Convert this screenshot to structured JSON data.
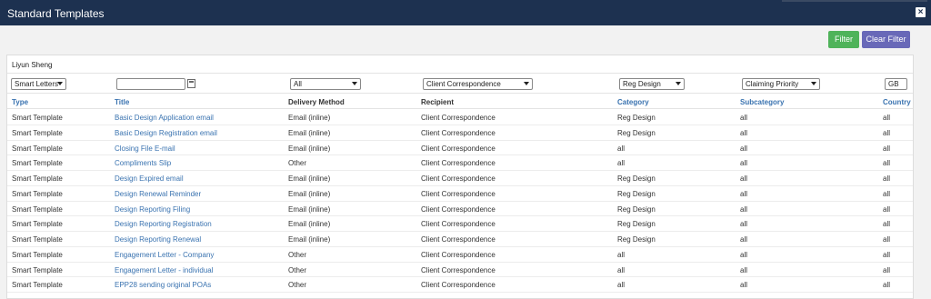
{
  "window": {
    "title": "Standard Templates",
    "close_icon": "×"
  },
  "toolbar": {
    "filter_label": "Filter",
    "clear_filter_label": "Clear Filter"
  },
  "user": "Liyun Sheng",
  "filters": {
    "type": "Smart Letters",
    "title": "",
    "delivery": "All",
    "recipient": "Client Correspondence",
    "category": "Reg Design",
    "subcategory": "Claiming Priority",
    "country": "GB"
  },
  "headers": [
    "Type",
    "Title",
    "Delivery Method",
    "Recipient",
    "Category",
    "Subcategory",
    "Country"
  ],
  "rows": [
    [
      "Smart Template",
      "Basic Design Application email",
      "Email (inline)",
      "Client Correspondence",
      "Reg Design",
      "all",
      "all"
    ],
    [
      "Smart Template",
      "Basic Design Registration email",
      "Email (inline)",
      "Client Correspondence",
      "Reg Design",
      "all",
      "all"
    ],
    [
      "Smart Template",
      "Closing File E-mail",
      "Email (inline)",
      "Client Correspondence",
      "all",
      "all",
      "all"
    ],
    [
      "Smart Template",
      "Compliments Slip",
      "Other",
      "Client Correspondence",
      "all",
      "all",
      "all"
    ],
    [
      "Smart Template",
      "Design Expired email",
      "Email (inline)",
      "Client Correspondence",
      "Reg Design",
      "all",
      "all"
    ],
    [
      "Smart Template",
      "Design Renewal Reminder",
      "Email (inline)",
      "Client Correspondence",
      "Reg Design",
      "all",
      "all"
    ],
    [
      "Smart Template",
      "Design Reporting Filing",
      "Email (inline)",
      "Client Correspondence",
      "Reg Design",
      "all",
      "all"
    ],
    [
      "Smart Template",
      "Design Reporting Registration",
      "Email (inline)",
      "Client Correspondence",
      "Reg Design",
      "all",
      "all"
    ],
    [
      "Smart Template",
      "Design Reporting Renewal",
      "Email (inline)",
      "Client Correspondence",
      "Reg Design",
      "all",
      "all"
    ],
    [
      "Smart Template",
      "Engagement Letter - Company",
      "Other",
      "Client Correspondence",
      "all",
      "all",
      "all"
    ],
    [
      "Smart Template",
      "Engagement Letter - individual",
      "Other",
      "Client Correspondence",
      "all",
      "all",
      "all"
    ],
    [
      "Smart Template",
      "EPP28 sending original POAs",
      "Other",
      "Client Correspondence",
      "all",
      "all",
      "all"
    ]
  ]
}
